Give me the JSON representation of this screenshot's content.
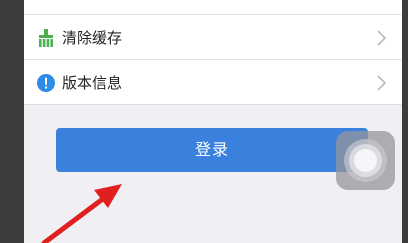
{
  "settings": {
    "items": [
      {
        "label": "清除缓存",
        "icon": "broom-icon",
        "icon_color": "#4caf50"
      },
      {
        "label": "版本信息",
        "icon": "info-icon",
        "icon_color": "#2d8ce6"
      }
    ]
  },
  "login": {
    "label": "登录"
  },
  "colors": {
    "accent": "#3a80dd",
    "annotation_arrow": "#e02020"
  }
}
